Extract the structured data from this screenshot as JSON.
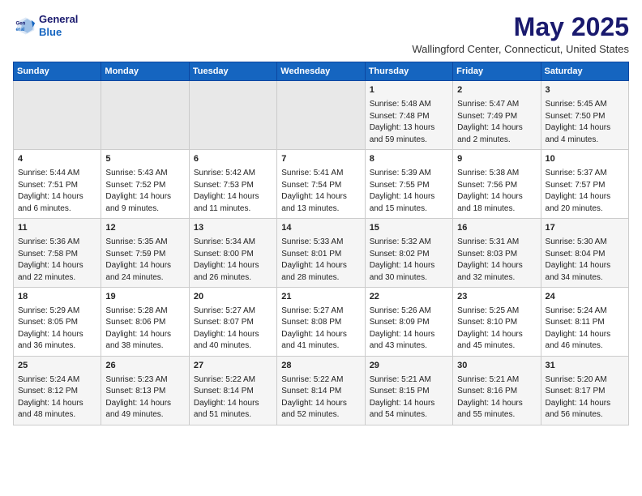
{
  "header": {
    "logo_line1": "General",
    "logo_line2": "Blue",
    "month_title": "May 2025",
    "location": "Wallingford Center, Connecticut, United States"
  },
  "days_of_week": [
    "Sunday",
    "Monday",
    "Tuesday",
    "Wednesday",
    "Thursday",
    "Friday",
    "Saturday"
  ],
  "weeks": [
    [
      {
        "day": "",
        "content": ""
      },
      {
        "day": "",
        "content": ""
      },
      {
        "day": "",
        "content": ""
      },
      {
        "day": "",
        "content": ""
      },
      {
        "day": "1",
        "content": "Sunrise: 5:48 AM\nSunset: 7:48 PM\nDaylight: 13 hours and 59 minutes."
      },
      {
        "day": "2",
        "content": "Sunrise: 5:47 AM\nSunset: 7:49 PM\nDaylight: 14 hours and 2 minutes."
      },
      {
        "day": "3",
        "content": "Sunrise: 5:45 AM\nSunset: 7:50 PM\nDaylight: 14 hours and 4 minutes."
      }
    ],
    [
      {
        "day": "4",
        "content": "Sunrise: 5:44 AM\nSunset: 7:51 PM\nDaylight: 14 hours and 6 minutes."
      },
      {
        "day": "5",
        "content": "Sunrise: 5:43 AM\nSunset: 7:52 PM\nDaylight: 14 hours and 9 minutes."
      },
      {
        "day": "6",
        "content": "Sunrise: 5:42 AM\nSunset: 7:53 PM\nDaylight: 14 hours and 11 minutes."
      },
      {
        "day": "7",
        "content": "Sunrise: 5:41 AM\nSunset: 7:54 PM\nDaylight: 14 hours and 13 minutes."
      },
      {
        "day": "8",
        "content": "Sunrise: 5:39 AM\nSunset: 7:55 PM\nDaylight: 14 hours and 15 minutes."
      },
      {
        "day": "9",
        "content": "Sunrise: 5:38 AM\nSunset: 7:56 PM\nDaylight: 14 hours and 18 minutes."
      },
      {
        "day": "10",
        "content": "Sunrise: 5:37 AM\nSunset: 7:57 PM\nDaylight: 14 hours and 20 minutes."
      }
    ],
    [
      {
        "day": "11",
        "content": "Sunrise: 5:36 AM\nSunset: 7:58 PM\nDaylight: 14 hours and 22 minutes."
      },
      {
        "day": "12",
        "content": "Sunrise: 5:35 AM\nSunset: 7:59 PM\nDaylight: 14 hours and 24 minutes."
      },
      {
        "day": "13",
        "content": "Sunrise: 5:34 AM\nSunset: 8:00 PM\nDaylight: 14 hours and 26 minutes."
      },
      {
        "day": "14",
        "content": "Sunrise: 5:33 AM\nSunset: 8:01 PM\nDaylight: 14 hours and 28 minutes."
      },
      {
        "day": "15",
        "content": "Sunrise: 5:32 AM\nSunset: 8:02 PM\nDaylight: 14 hours and 30 minutes."
      },
      {
        "day": "16",
        "content": "Sunrise: 5:31 AM\nSunset: 8:03 PM\nDaylight: 14 hours and 32 minutes."
      },
      {
        "day": "17",
        "content": "Sunrise: 5:30 AM\nSunset: 8:04 PM\nDaylight: 14 hours and 34 minutes."
      }
    ],
    [
      {
        "day": "18",
        "content": "Sunrise: 5:29 AM\nSunset: 8:05 PM\nDaylight: 14 hours and 36 minutes."
      },
      {
        "day": "19",
        "content": "Sunrise: 5:28 AM\nSunset: 8:06 PM\nDaylight: 14 hours and 38 minutes."
      },
      {
        "day": "20",
        "content": "Sunrise: 5:27 AM\nSunset: 8:07 PM\nDaylight: 14 hours and 40 minutes."
      },
      {
        "day": "21",
        "content": "Sunrise: 5:27 AM\nSunset: 8:08 PM\nDaylight: 14 hours and 41 minutes."
      },
      {
        "day": "22",
        "content": "Sunrise: 5:26 AM\nSunset: 8:09 PM\nDaylight: 14 hours and 43 minutes."
      },
      {
        "day": "23",
        "content": "Sunrise: 5:25 AM\nSunset: 8:10 PM\nDaylight: 14 hours and 45 minutes."
      },
      {
        "day": "24",
        "content": "Sunrise: 5:24 AM\nSunset: 8:11 PM\nDaylight: 14 hours and 46 minutes."
      }
    ],
    [
      {
        "day": "25",
        "content": "Sunrise: 5:24 AM\nSunset: 8:12 PM\nDaylight: 14 hours and 48 minutes."
      },
      {
        "day": "26",
        "content": "Sunrise: 5:23 AM\nSunset: 8:13 PM\nDaylight: 14 hours and 49 minutes."
      },
      {
        "day": "27",
        "content": "Sunrise: 5:22 AM\nSunset: 8:14 PM\nDaylight: 14 hours and 51 minutes."
      },
      {
        "day": "28",
        "content": "Sunrise: 5:22 AM\nSunset: 8:14 PM\nDaylight: 14 hours and 52 minutes."
      },
      {
        "day": "29",
        "content": "Sunrise: 5:21 AM\nSunset: 8:15 PM\nDaylight: 14 hours and 54 minutes."
      },
      {
        "day": "30",
        "content": "Sunrise: 5:21 AM\nSunset: 8:16 PM\nDaylight: 14 hours and 55 minutes."
      },
      {
        "day": "31",
        "content": "Sunrise: 5:20 AM\nSunset: 8:17 PM\nDaylight: 14 hours and 56 minutes."
      }
    ]
  ]
}
